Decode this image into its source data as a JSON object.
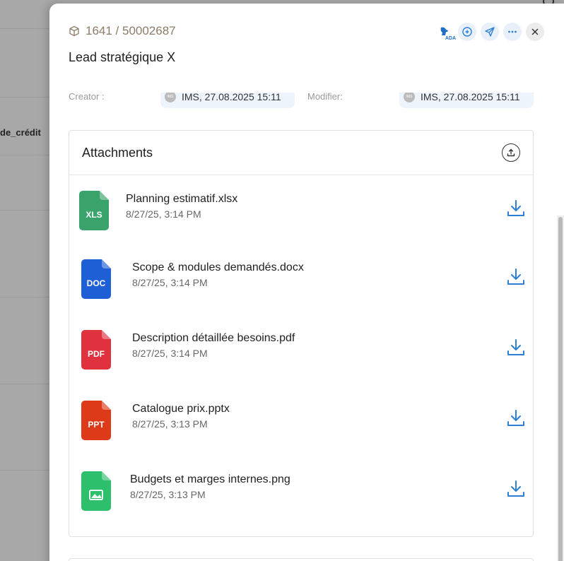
{
  "background": {
    "partial_label": "de_crédit"
  },
  "header": {
    "record_id": "1641 / 50002687",
    "title": "Lead stratégique X",
    "actions": {
      "ada_badge": "ADA"
    }
  },
  "meta": {
    "creator_label": "Creator :",
    "creator_value": "IMS, 27.08.2025 15:11",
    "modifier_label": "Modifier:",
    "modifier_value": "IMS, 27.08.2025 15:11",
    "avatar_text": "IMS"
  },
  "attachments": {
    "title": "Attachments",
    "files": [
      {
        "name": "Planning estimatif.xlsx",
        "date": "8/27/25, 3:14 PM",
        "type": "XLS",
        "color": "#3aa36c"
      },
      {
        "name": "Scope & modules demandés.docx",
        "date": "8/27/25, 3:14 PM",
        "type": "DOC",
        "color": "#1f5fd6"
      },
      {
        "name": "Description détaillée besoins.pdf",
        "date": "8/27/25, 3:14 PM",
        "type": "PDF",
        "color": "#e0313f"
      },
      {
        "name": "Catalogue prix.pptx",
        "date": "8/27/25, 3:13 PM",
        "type": "PPT",
        "color": "#dd3a1a"
      },
      {
        "name": "Budgets et marges internes.png",
        "date": "8/27/25, 3:13 PM",
        "type": "image",
        "color": "#2dbf6c"
      }
    ]
  },
  "colors": {
    "accent": "#2d7fd3",
    "id_text": "#8a7c68"
  }
}
